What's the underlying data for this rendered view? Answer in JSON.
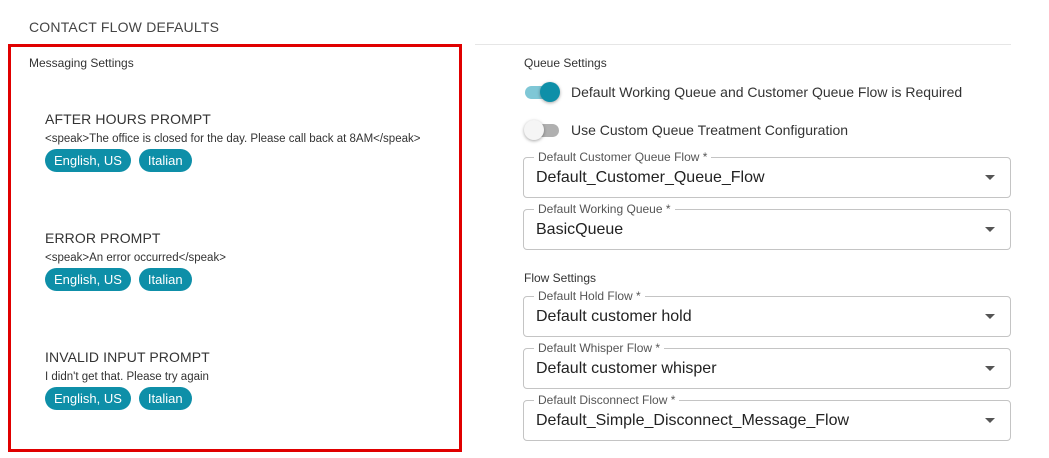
{
  "section_title": "CONTACT FLOW DEFAULTS",
  "messaging": {
    "heading": "Messaging Settings",
    "prompts": [
      {
        "title": "AFTER HOURS PROMPT",
        "text": "<speak>The office is closed for the day. Please call back at 8AM</speak>",
        "languages": [
          "English, US",
          "Italian"
        ]
      },
      {
        "title": "ERROR PROMPT",
        "text": "<speak>An error occurred</speak>",
        "languages": [
          "English, US",
          "Italian"
        ]
      },
      {
        "title": "INVALID INPUT PROMPT",
        "text": "I didn't get that. Please try again",
        "languages": [
          "English, US",
          "Italian"
        ]
      }
    ]
  },
  "queue": {
    "heading": "Queue Settings",
    "toggles": [
      {
        "label": "Default Working Queue and Customer Queue Flow is Required",
        "on": true
      },
      {
        "label": "Use Custom Queue Treatment Configuration",
        "on": false
      }
    ],
    "fields": [
      {
        "label": "Default Customer Queue Flow *",
        "value": "Default_Customer_Queue_Flow"
      },
      {
        "label": "Default Working Queue *",
        "value": "BasicQueue"
      }
    ]
  },
  "flow": {
    "heading": "Flow Settings",
    "fields": [
      {
        "label": "Default Hold Flow *",
        "value": "Default customer hold"
      },
      {
        "label": "Default Whisper Flow *",
        "value": "Default customer whisper"
      },
      {
        "label": "Default Disconnect Flow *",
        "value": "Default_Simple_Disconnect_Message_Flow"
      }
    ]
  },
  "colors": {
    "accent": "#0e8fa8",
    "highlight": "#e00000"
  }
}
